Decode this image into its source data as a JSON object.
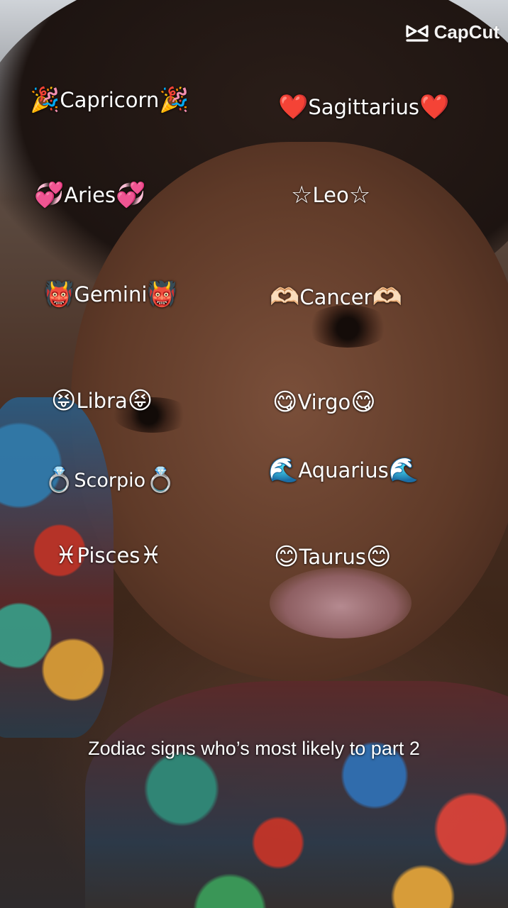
{
  "watermark": {
    "brand": "CapCut",
    "icon": "capcut-logo-icon"
  },
  "signs": [
    {
      "id": "capricorn",
      "label": "Capricorn",
      "emoji": "🎉"
    },
    {
      "id": "sagittarius",
      "label": "Sagittarius",
      "emoji": "❤️"
    },
    {
      "id": "aries",
      "label": "Aries",
      "emoji": "💞"
    },
    {
      "id": "leo",
      "label": "Leo",
      "emoji": "☆"
    },
    {
      "id": "gemini",
      "label": "Gemini",
      "emoji": "👹"
    },
    {
      "id": "cancer",
      "label": "Cancer",
      "emoji": "🫶🏻"
    },
    {
      "id": "libra",
      "label": "Libra",
      "emoji": "😝"
    },
    {
      "id": "virgo",
      "label": "Virgo",
      "emoji": "😋"
    },
    {
      "id": "scorpio",
      "label": "Scorpio",
      "emoji": "💍"
    },
    {
      "id": "aquarius",
      "label": "Aquarius",
      "emoji": "🌊"
    },
    {
      "id": "pisces",
      "label": "Pisces",
      "emoji": "♓"
    },
    {
      "id": "taurus",
      "label": "Taurus",
      "emoji": "😊"
    }
  ],
  "caption": "Zodiac signs who’s most likely to part 2"
}
